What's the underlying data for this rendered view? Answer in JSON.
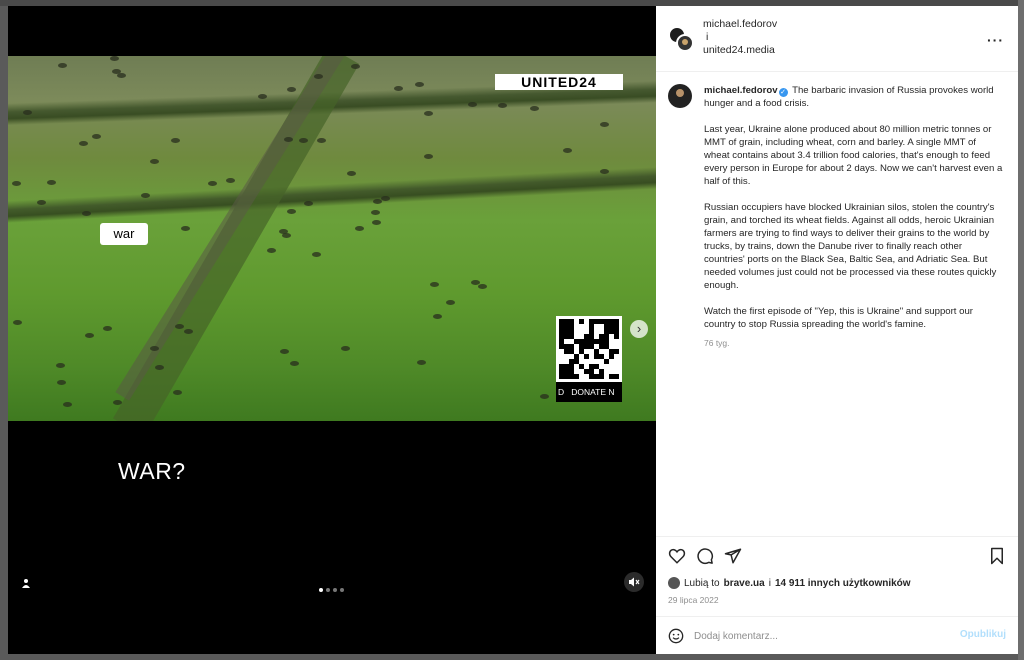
{
  "media": {
    "logo_text": "UNITED24",
    "overlay_word": "war",
    "qr_label": "DONATE N",
    "qr_label_prefix": "D",
    "caption": "WAR?",
    "carousel_dots": 4,
    "active_dot": 0
  },
  "header": {
    "user1": "michael.fedorov",
    "and": "i",
    "user2": "united24.media"
  },
  "post": {
    "author": "michael.fedorov",
    "intro": "The barbaric invasion of Russia provokes world hunger and a food crisis.",
    "paragraphs": [
      "Last year, Ukraine alone produced about 80 million metric tonnes or MMT of grain, including wheat, corn and barley. A single MMT of wheat contains about 3.4 trillion food calories, that's enough to feed every person in Europe for about 2 days. Now we can't harvest even a half of this.",
      "Russian occupiers have blocked Ukrainian silos, stolen the country's grain, and torched its wheat fields. Against all odds, heroic Ukrainian farmers are trying to find ways to deliver their grains to the world by trucks, by trains, down the Danube river to finally reach other countries' ports on the Black Sea, Baltic Sea, and Adriatic Sea. But needed volumes just could not be processed via these routes quickly enough.",
      "Watch the first episode of \"Yep, this is Ukraine\" and support our country to stop Russia spreading the world's famine."
    ],
    "time_ago": "76 tyg."
  },
  "likes": {
    "prefix": "Lubią to",
    "user": "brave.ua",
    "and": "i",
    "others": "14 911 innych użytkowników"
  },
  "date": "29 lipca 2022",
  "add_comment": {
    "placeholder": "Dodaj komentarz...",
    "publish": "Opublikuj"
  },
  "icons": {
    "like": "heart-icon",
    "comment": "comment-icon",
    "share": "share-icon",
    "save": "bookmark-icon",
    "emoji": "emoji-icon",
    "more": "more-icon",
    "mute": "mute-icon",
    "tag": "user-tag-icon",
    "next": "chevron-right-icon"
  },
  "colors": {
    "verified": "#3897f0",
    "publish_disabled": "#b2dffc",
    "muted_text": "#8e8e8e"
  }
}
